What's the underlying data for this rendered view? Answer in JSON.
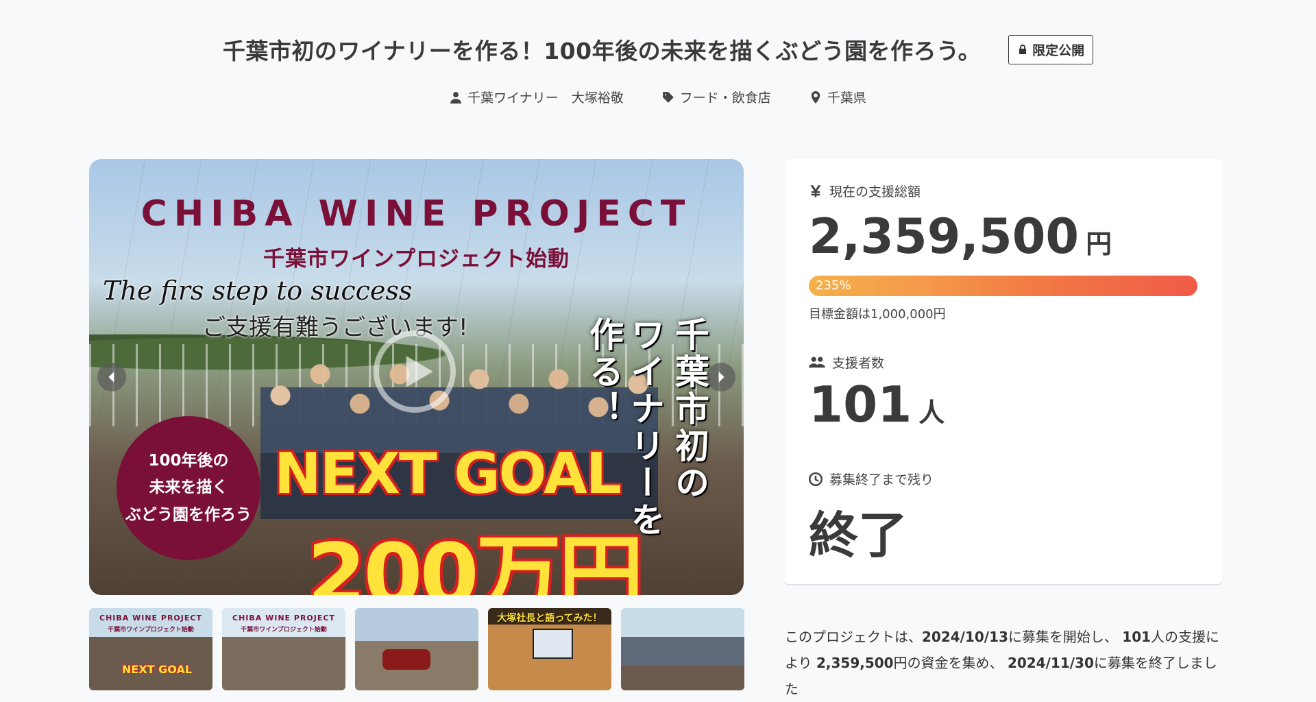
{
  "header": {
    "title": "千葉市初のワイナリーを作る！100年後の未来を描くぶどう園を作ろう。",
    "badge": "限定公開"
  },
  "meta": {
    "owner": "千葉ワイナリー　大塚裕敬",
    "category": "フード・飲食店",
    "location": "千葉県"
  },
  "hero": {
    "headline": "CHIBA WINE PROJECT",
    "subheadline": "千葉市ワインプロジェクト始動",
    "script_text": "The firs step to success",
    "thanks_text": "ご支援有難うございます!",
    "vertical_1": "千葉市初の",
    "vertical_2": "ワイナリーを",
    "vertical_3": "作る！",
    "circle_line1": "100年後の",
    "circle_line2": "未来を描く",
    "circle_line3": "ぶどう園を作ろう",
    "next_goal": "NEXT GOAL",
    "goal_amount": "200万円"
  },
  "thumbnails": [
    {
      "title": "CHIBA WINE PROJECT",
      "sub": "千葉市ワインプロジェクト始動",
      "goal": "NEXT GOAL"
    },
    {
      "title": "CHIBA WINE PROJECT",
      "sub": "千葉市ワインプロジェクト始動"
    },
    {
      "title": ""
    },
    {
      "title": "大塚社長と語ってみた！"
    },
    {
      "title": ""
    }
  ],
  "stats": {
    "total_label": "現在の支援総額",
    "total_value": "2,359,500",
    "total_unit": "円",
    "progress_label": "235%",
    "progress_fraction": 1.0,
    "goal_text": "目標金額は1,000,000円",
    "backers_label": "支援者数",
    "backers_value": "101",
    "backers_unit": "人",
    "remaining_label": "募集終了まで残り",
    "remaining_value": "終了"
  },
  "summary": {
    "p1": "このプロジェクトは、",
    "start_date": "2024/10/13",
    "p2": "に募集を開始し、",
    "backers": "101",
    "p3": "人の支援により",
    "amount": "2,359,500",
    "p4": "円の資金を集め、",
    "end_date": "2024/11/30",
    "p5": "に募集を終了しました"
  },
  "colors": {
    "brand_wine": "#7a1038",
    "progress_start": "#f5b14a",
    "progress_end": "#f05a48"
  }
}
